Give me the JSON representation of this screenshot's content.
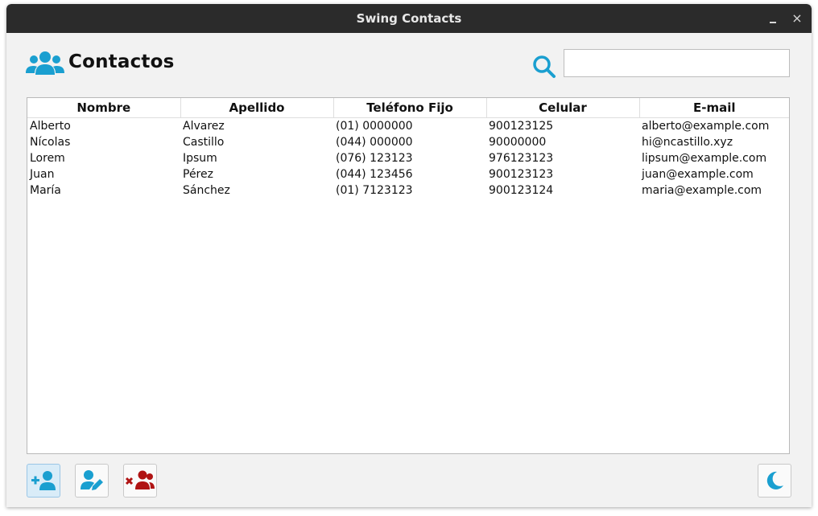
{
  "window": {
    "title": "Swing Contacts",
    "minimize_icon": "minimize-icon",
    "close_glyph": "×"
  },
  "header": {
    "title": "Contactos",
    "icon": "users-icon",
    "search_icon": "search-icon",
    "search_value": "",
    "accent_color": "#1a9fd0"
  },
  "table": {
    "columns": [
      "Nombre",
      "Apellido",
      "Teléfono Fijo",
      "Celular",
      "E-mail"
    ],
    "rows": [
      [
        "Alberto",
        "Alvarez",
        "(01) 0000000",
        "900123125",
        "alberto@example.com"
      ],
      [
        "Nícolas",
        "Castillo",
        "(044) 000000",
        "90000000",
        "hi@ncastillo.xyz"
      ],
      [
        "Lorem",
        "Ipsum",
        "(076) 123123",
        "976123123",
        "lipsum@example.com"
      ],
      [
        "Juan",
        "Pérez",
        "(044) 123456",
        "900123123",
        "juan@example.com"
      ],
      [
        "María",
        "Sánchez",
        "(01) 7123123",
        "900123124",
        "maria@example.com"
      ]
    ]
  },
  "toolbar": {
    "add_icon": "add-user-icon",
    "edit_icon": "edit-user-icon",
    "delete_icon": "delete-users-icon",
    "theme_icon": "moon-icon",
    "delete_color": "#b01414"
  }
}
